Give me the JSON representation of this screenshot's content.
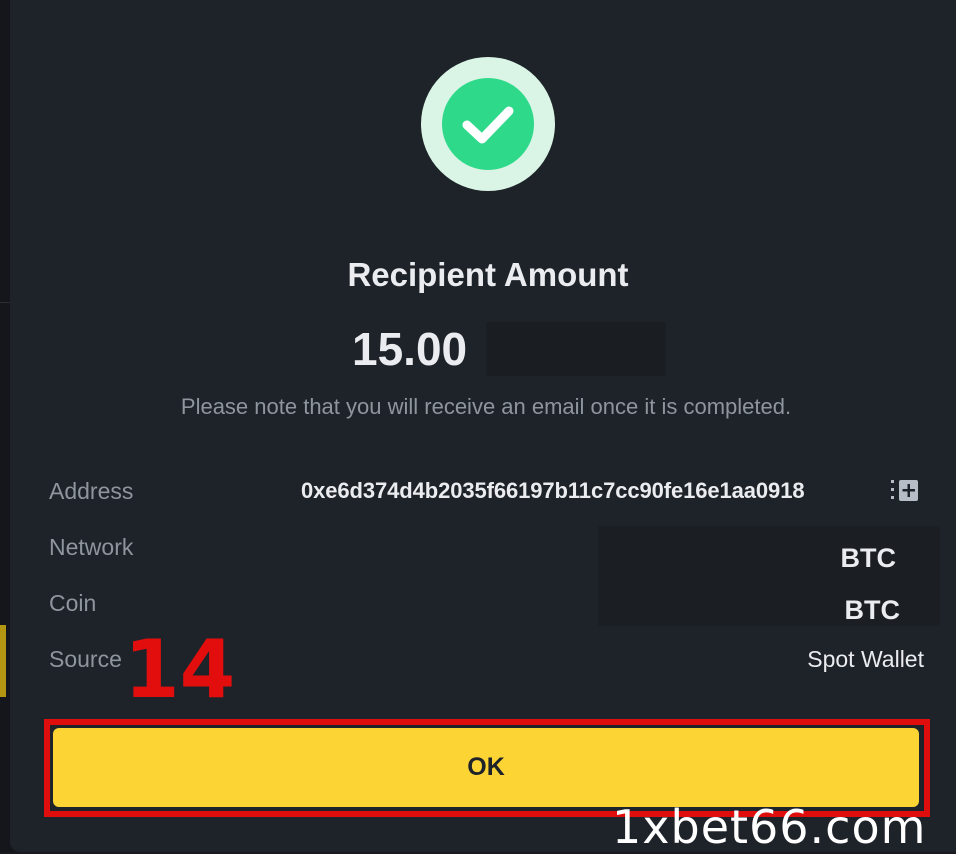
{
  "dialog": {
    "title": "Recipient Amount",
    "amount": "15.00",
    "note": "Please note that you will receive an email once it is completed.",
    "rows": [
      {
        "label": "Address",
        "value": "0xe6d374d4b2035f66197b11c7cc90fe16e1aa0918"
      },
      {
        "label": "Network",
        "value": "BTC"
      },
      {
        "label": "Coin",
        "value": "BTC"
      },
      {
        "label": "Source",
        "value": "Spot Wallet"
      }
    ],
    "ok_label": "OK",
    "icons": {
      "status": "success-check-icon",
      "copy": "copy-icon"
    }
  },
  "annotation": {
    "step_number": "14"
  },
  "watermark": "1xbet66.com",
  "colors": {
    "accent": "#fcd535",
    "success": "#2ed98a",
    "highlight": "#e00d0d",
    "panel": "#1e2329"
  }
}
